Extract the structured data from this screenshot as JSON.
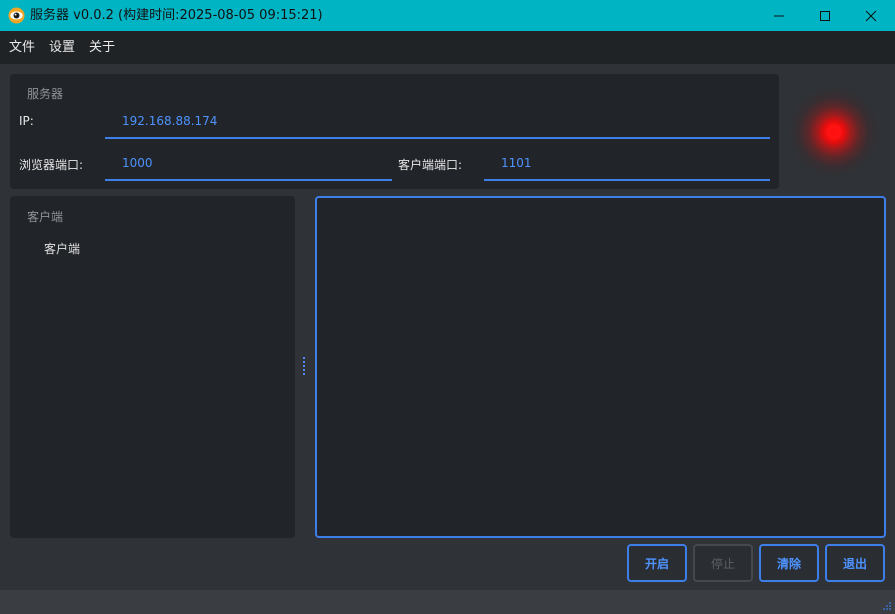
{
  "window": {
    "title": "服务器 v0.0.2 (构建时间:2025-08-05 09:15:21)",
    "icons": {
      "app": "eye-icon",
      "minimize": "minimize-icon",
      "maximize": "maximize-icon",
      "close": "close-icon"
    }
  },
  "menu": {
    "file": "文件",
    "settings": "设置",
    "about": "关于"
  },
  "server": {
    "group_title": "服务器",
    "ip_label": "IP:",
    "ip_value": "192.168.88.174",
    "browser_port_label": "浏览器端口:",
    "browser_port_value": "1000",
    "client_port_label": "客户端端口:",
    "client_port_value": "1101"
  },
  "status_light": {
    "state": "stopped",
    "color": "#ff1010"
  },
  "clients": {
    "group_title": "客户端",
    "items": [
      "客户端"
    ]
  },
  "log": {
    "lines": []
  },
  "buttons": {
    "start": "开启",
    "stop": "停止",
    "clear": "清除",
    "exit": "退出"
  },
  "colors": {
    "titlebar": "#00b4c4",
    "accent": "#3d7ee8",
    "panel": "#212428",
    "background": "#2f3236"
  }
}
